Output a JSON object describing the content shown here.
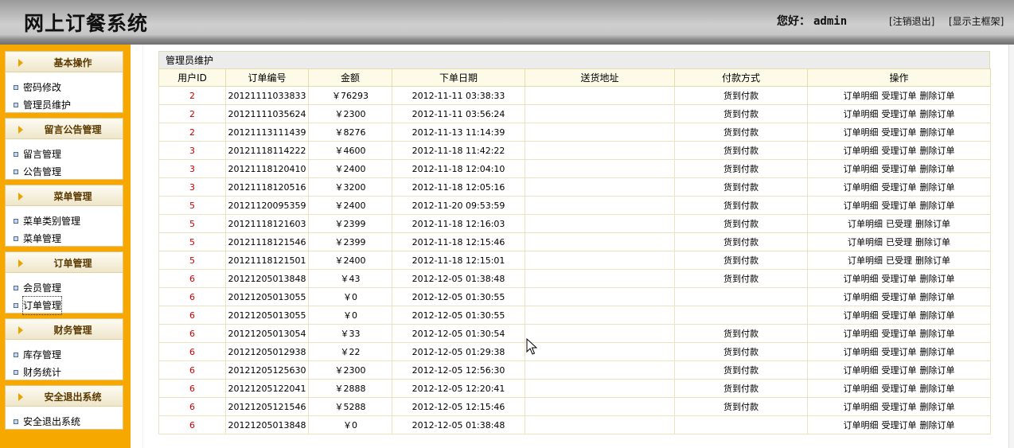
{
  "header": {
    "app_title": "网上订餐系统",
    "greeting_label": "您好：",
    "username": "admin",
    "logout_link": "[注销退出]",
    "frame_link": "[显示主框架]"
  },
  "sidebar": [
    {
      "title": "基本操作",
      "items": [
        "密码修改",
        "管理员维护"
      ]
    },
    {
      "title": "留言公告管理",
      "items": [
        "留言管理",
        "公告管理"
      ]
    },
    {
      "title": "菜单管理",
      "items": [
        "菜单类别管理",
        "菜单管理"
      ]
    },
    {
      "title": "订单管理",
      "items": [
        "会员管理",
        "订单管理"
      ]
    },
    {
      "title": "财务管理",
      "items": [
        "库存管理",
        "财务统计"
      ]
    },
    {
      "title": "安全退出系统",
      "items": [
        "安全退出系统"
      ]
    }
  ],
  "main": {
    "section_title": "管理员维护",
    "columns": [
      "用户ID",
      "订单编号",
      "金额",
      "下单日期",
      "送货地址",
      "付款方式",
      "操作"
    ],
    "rows": [
      {
        "uid": "2",
        "order_no": "20121111033833",
        "amount": "￥76293",
        "date": "2012-11-11 03:38:33",
        "address": "",
        "payment": "货到付款",
        "ops": [
          "订单明细",
          "受理订单",
          "删除订单"
        ]
      },
      {
        "uid": "2",
        "order_no": "20121111035624",
        "amount": "￥2300",
        "date": "2012-11-11 03:56:24",
        "address": "",
        "payment": "货到付款",
        "ops": [
          "订单明细",
          "受理订单",
          "删除订单"
        ]
      },
      {
        "uid": "2",
        "order_no": "20121113111439",
        "amount": "￥8276",
        "date": "2012-11-13 11:14:39",
        "address": "",
        "payment": "货到付款",
        "ops": [
          "订单明细",
          "受理订单",
          "删除订单"
        ]
      },
      {
        "uid": "3",
        "order_no": "20121118114222",
        "amount": "￥4600",
        "date": "2012-11-18 11:42:22",
        "address": "",
        "payment": "货到付款",
        "ops": [
          "订单明细",
          "受理订单",
          "删除订单"
        ]
      },
      {
        "uid": "3",
        "order_no": "20121118120410",
        "amount": "￥2400",
        "date": "2012-11-18 12:04:10",
        "address": "",
        "payment": "货到付款",
        "ops": [
          "订单明细",
          "受理订单",
          "删除订单"
        ]
      },
      {
        "uid": "3",
        "order_no": "20121118120516",
        "amount": "￥3200",
        "date": "2012-11-18 12:05:16",
        "address": "",
        "payment": "货到付款",
        "ops": [
          "订单明细",
          "受理订单",
          "删除订单"
        ]
      },
      {
        "uid": "5",
        "order_no": "20121120095359",
        "amount": "￥2400",
        "date": "2012-11-20 09:53:59",
        "address": "",
        "payment": "货到付款",
        "ops": [
          "订单明细",
          "受理订单",
          "删除订单"
        ]
      },
      {
        "uid": "5",
        "order_no": "20121118121603",
        "amount": "￥2399",
        "date": "2012-11-18 12:16:03",
        "address": "",
        "payment": "货到付款",
        "ops": [
          "订单明细",
          "已受理",
          "删除订单"
        ]
      },
      {
        "uid": "5",
        "order_no": "20121118121546",
        "amount": "￥2399",
        "date": "2012-11-18 12:15:46",
        "address": "",
        "payment": "货到付款",
        "ops": [
          "订单明细",
          "已受理",
          "删除订单"
        ]
      },
      {
        "uid": "5",
        "order_no": "20121118121501",
        "amount": "￥2400",
        "date": "2012-11-18 12:15:01",
        "address": "",
        "payment": "货到付款",
        "ops": [
          "订单明细",
          "已受理",
          "删除订单"
        ]
      },
      {
        "uid": "6",
        "order_no": "20121205013848",
        "amount": "￥43",
        "date": "2012-12-05 01:38:48",
        "address": "",
        "payment": "货到付款",
        "ops": [
          "订单明细",
          "受理订单",
          "删除订单"
        ]
      },
      {
        "uid": "6",
        "order_no": "20121205013055",
        "amount": "￥0",
        "date": "2012-12-05 01:30:55",
        "address": "",
        "payment": "",
        "ops": [
          "订单明细",
          "受理订单",
          "删除订单"
        ]
      },
      {
        "uid": "6",
        "order_no": "20121205013055",
        "amount": "￥0",
        "date": "2012-12-05 01:30:55",
        "address": "",
        "payment": "",
        "ops": [
          "订单明细",
          "受理订单",
          "删除订单"
        ]
      },
      {
        "uid": "6",
        "order_no": "20121205013054",
        "amount": "￥33",
        "date": "2012-12-05 01:30:54",
        "address": "",
        "payment": "货到付款",
        "ops": [
          "订单明细",
          "受理订单",
          "删除订单"
        ]
      },
      {
        "uid": "6",
        "order_no": "20121205012938",
        "amount": "￥22",
        "date": "2012-12-05 01:29:38",
        "address": "",
        "payment": "货到付款",
        "ops": [
          "订单明细",
          "受理订单",
          "删除订单"
        ]
      },
      {
        "uid": "6",
        "order_no": "20121205125630",
        "amount": "￥2300",
        "date": "2012-12-05 12:56:30",
        "address": "",
        "payment": "货到付款",
        "ops": [
          "订单明细",
          "受理订单",
          "删除订单"
        ]
      },
      {
        "uid": "6",
        "order_no": "20121205122041",
        "amount": "￥2888",
        "date": "2012-12-05 12:20:41",
        "address": "",
        "payment": "货到付款",
        "ops": [
          "订单明细",
          "受理订单",
          "删除订单"
        ]
      },
      {
        "uid": "6",
        "order_no": "20121205121546",
        "amount": "￥5288",
        "date": "2012-12-05 12:15:46",
        "address": "",
        "payment": "货到付款",
        "ops": [
          "订单明细",
          "受理订单",
          "删除订单"
        ]
      },
      {
        "uid": "6",
        "order_no": "20121205013848",
        "amount": "￥0",
        "date": "2012-12-05 01:38:48",
        "address": "",
        "payment": "",
        "ops": [
          "订单明细",
          "受理订单",
          "删除订单"
        ]
      }
    ]
  },
  "colors": {
    "sidebar_bg": "#f7a800",
    "user_id_red": "#d00000"
  }
}
